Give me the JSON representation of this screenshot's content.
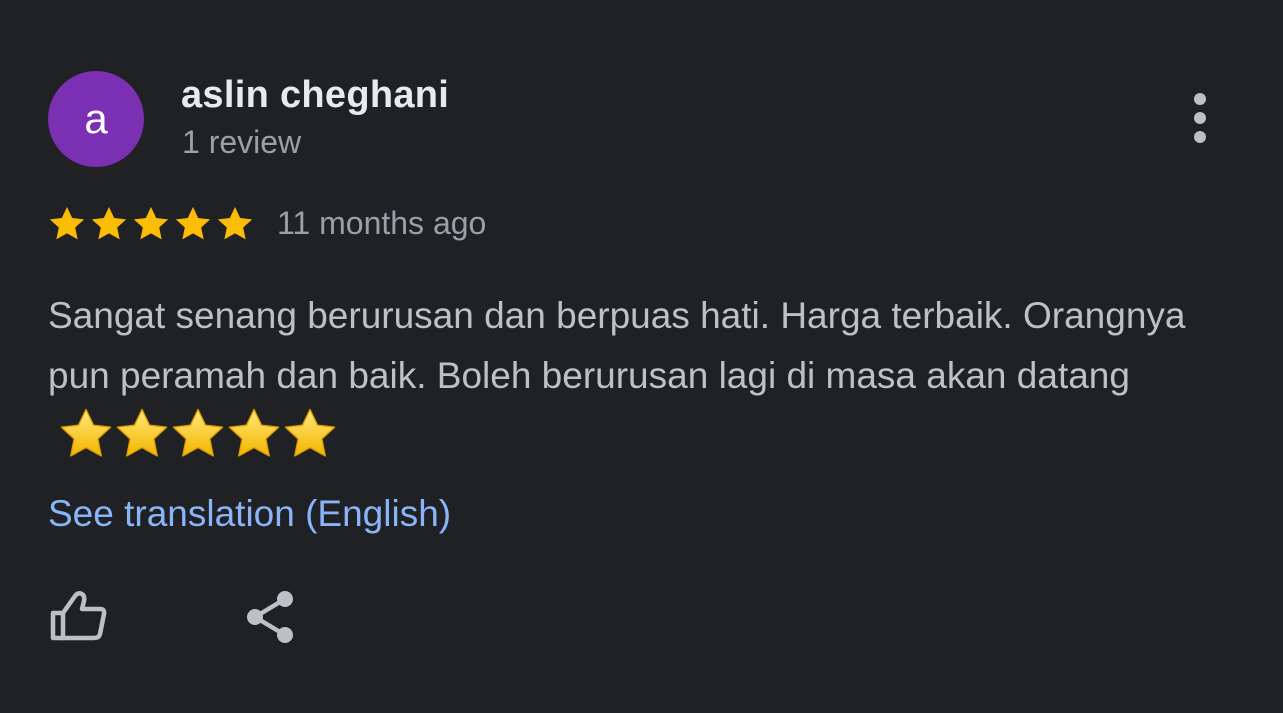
{
  "reviewer": {
    "avatar_letter": "a",
    "name": "aslin cheghani",
    "review_count": "1 review"
  },
  "review": {
    "rating": 5,
    "rating_max": 5,
    "date": "11 months ago",
    "text": "Sangat senang berurusan dan berpuas hati. Harga terbaik. Orangnya pun peramah dan baik. Boleh berurusan lagi di masa akan datang",
    "emoji": "⭐⭐⭐⭐⭐",
    "translation_link": "See translation (English)"
  },
  "actions": {
    "more_icon": "more-vert-icon",
    "like_icon": "thumb-up-icon",
    "share_icon": "share-icon"
  },
  "colors": {
    "background": "#202124",
    "avatar": "#7b2fb3",
    "star": "#fbbc04",
    "link": "#8ab4f8"
  }
}
